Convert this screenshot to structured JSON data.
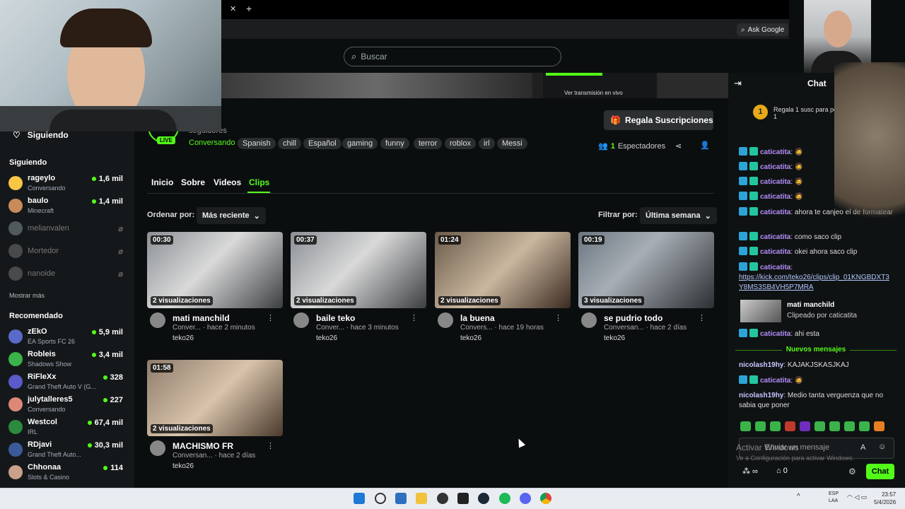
{
  "browser": {
    "ask_google": "Ask Google"
  },
  "search": {
    "placeholder": "Buscar"
  },
  "banner": {
    "live_link": "Ver transmisión en vivo"
  },
  "sidebar": {
    "siguiendo_top": "Siguiendo",
    "following_header": "Siguiendo",
    "following": [
      {
        "name": "rageylo",
        "sub": "Conversando",
        "count": "1,6 mil",
        "online": true
      },
      {
        "name": "baulo",
        "sub": "Minecraft",
        "count": "1,4 mil",
        "online": true
      },
      {
        "name": "melianvalen",
        "sub": "",
        "count": "",
        "online": false
      },
      {
        "name": "Mortedor",
        "sub": "",
        "count": "",
        "online": false
      },
      {
        "name": "nanoide",
        "sub": "",
        "count": "",
        "online": false
      }
    ],
    "show_more": "Mostrar más",
    "recommended_header": "Recomendado",
    "recommended": [
      {
        "name": "zEkO",
        "sub": "EA Sports FC 26",
        "count": "5,9 mil"
      },
      {
        "name": "Robleis",
        "sub": "Shadows Show",
        "count": "3,4 mil"
      },
      {
        "name": "RiFleXx",
        "sub": "Grand Theft Auto V (G...",
        "count": "328"
      },
      {
        "name": "julytalleres5",
        "sub": "Conversando",
        "count": "227"
      },
      {
        "name": "Westcol",
        "sub": "IRL",
        "count": "67,4 mil"
      },
      {
        "name": "RDjavi",
        "sub": "Grand Theft Auto...",
        "count": "30,3 mil"
      },
      {
        "name": "Chhonaa",
        "sub": "Slots & Casino",
        "count": "114"
      }
    ]
  },
  "channel": {
    "live": "LIVE",
    "followers": "seguidores",
    "category": "Conversando",
    "tags": [
      "Spanish",
      "chill",
      "Español",
      "gaming",
      "funny",
      "terror",
      "roblox",
      "irl",
      "Messi"
    ],
    "gift_button": "Regala Suscripciones",
    "viewers_count": "1",
    "viewers_label": "Espectadores"
  },
  "tabs": [
    "Inicio",
    "Sobre",
    "Videos",
    "Clips"
  ],
  "active_tab": "Clips",
  "sort": {
    "label": "Ordenar por:",
    "value": "Más reciente"
  },
  "filter": {
    "label": "Filtrar por:",
    "value": "Última semana"
  },
  "clips": [
    {
      "duration": "00:30",
      "views": "2 visualizaciones",
      "title": "mati manchild",
      "meta": "Conver... · hace 2 minutos",
      "author": "teko26"
    },
    {
      "duration": "00:37",
      "views": "2 visualizaciones",
      "title": "baile teko",
      "meta": "Conver... · hace 3 minutos",
      "author": "teko26"
    },
    {
      "duration": "01:24",
      "views": "2 visualizaciones",
      "title": "la buena",
      "meta": "Convers... · hace 19 horas",
      "author": "teko26"
    },
    {
      "duration": "00:19",
      "views": "3 visualizaciones",
      "title": "se pudrio todo",
      "meta": "Conversan... · hace 2 días",
      "author": "teko26"
    },
    {
      "duration": "01:58",
      "views": "2 visualizaciones",
      "title": "MACHISMO FR",
      "meta": "Conversan... · hace 2 días",
      "author": "teko26"
    }
  ],
  "chat": {
    "title": "Chat",
    "gift_notice": "Regala 1 susc para posición 1",
    "messages": [
      {
        "user": "caticatita",
        "text": ": 🧔"
      },
      {
        "user": "caticatita",
        "text": ": 🧔"
      },
      {
        "user": "caticatita",
        "text": ": 🧔"
      },
      {
        "user": "caticatita",
        "text": ": 🧔"
      },
      {
        "user": "caticatita",
        "text": ": ahora te canjeo el de formatear"
      },
      {
        "user": "caticatita",
        "text": ": como saco clip"
      },
      {
        "user": "caticatita",
        "text": ": okei ahora saco clip"
      },
      {
        "user": "caticatita",
        "text": ":"
      }
    ],
    "link": "https://kick.com/teko26/clips/clip_01KNGBDXT3Y8MS3SB4VH5P7MRA",
    "clip_card": {
      "title": "mati manchild",
      "sub": "Clipeado por caticatita"
    },
    "after_clip": {
      "user": "caticatita",
      "text": ": ahi esta"
    },
    "new_messages": "Nuevos mensajes",
    "new": [
      {
        "user": "nicolash19hy",
        "text": ": KAJAKJSKASJKAJ"
      },
      {
        "user": "caticatita",
        "text": ": 🧔"
      },
      {
        "user": "nicolash19hy",
        "text": ": Medio tanta verguenza que no sabia que poner"
      }
    ],
    "input_placeholder": "Enviar un mensaje",
    "points": "0",
    "send": "Chat"
  },
  "windows_watermark": {
    "line1": "Activar Windows",
    "line2": "Ve a Configuración para activar Windows."
  },
  "taskbar": {
    "lang1": "ESP",
    "lang2": "LAA",
    "time": "23:57",
    "date": "5/4/2026"
  }
}
